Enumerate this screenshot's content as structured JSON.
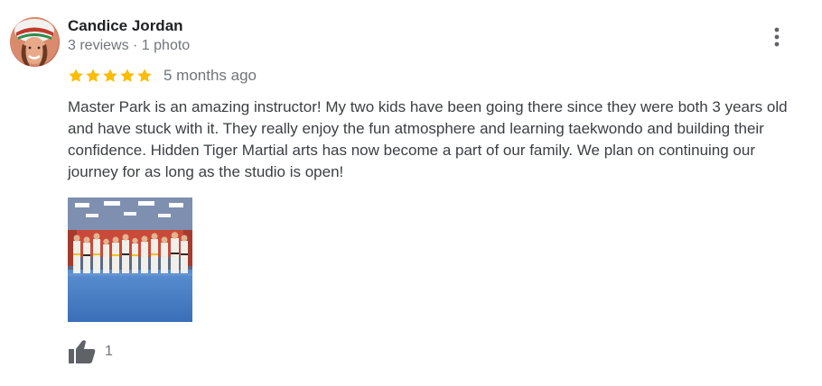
{
  "review": {
    "author_name": "Candice Jordan",
    "author_meta": "3 reviews · 1 photo",
    "rating": 5,
    "rating_max": 5,
    "date": "5 months ago",
    "text": "Master Park is an amazing instructor! My two kids have been going there since they were both 3 years old and have stuck with it. They really enjoy the fun atmosphere and learning taekwondo and building their confidence. Hidden Tiger Martial arts has now become a part of our family. We plan on continuing our journey for as long as the studio is open!",
    "like_count": "1"
  },
  "icons": {
    "more": "more-vert-icon",
    "like": "thumb-up-icon",
    "star": "star-icon"
  },
  "colors": {
    "star": "#fbbc04",
    "meta_text": "#70757a",
    "body_text": "#3c4043",
    "name_text": "#202124",
    "icon": "#5f6368"
  }
}
